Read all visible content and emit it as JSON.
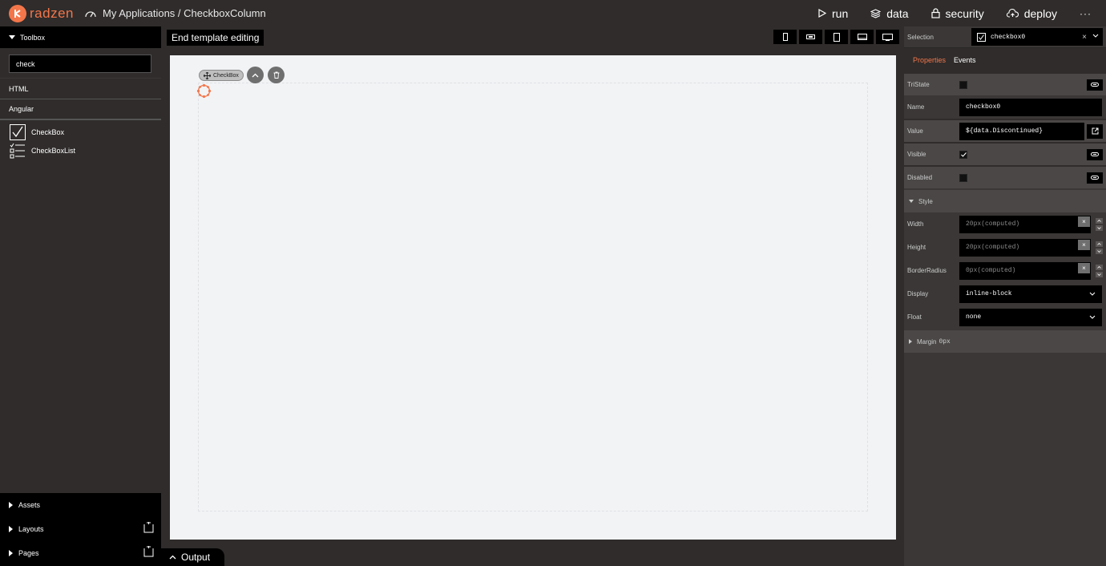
{
  "brand": {
    "name": "radzen",
    "accent": "#f3764a"
  },
  "breadcrumb": "My Applications / CheckboxColumn",
  "topnav": [
    {
      "label": "run",
      "icon": "play-icon"
    },
    {
      "label": "data",
      "icon": "layers-icon"
    },
    {
      "label": "security",
      "icon": "lock-icon"
    },
    {
      "label": "deploy",
      "icon": "cloud-upload-icon"
    },
    {
      "label": "···",
      "icon": "more-icon"
    }
  ],
  "toolbox": {
    "title": "Toolbox",
    "search_value": "check",
    "categories": [
      "HTML",
      "Angular"
    ],
    "tools": [
      "CheckBox",
      "CheckBoxList"
    ],
    "bottom": [
      "Assets",
      "Layouts",
      "Pages"
    ]
  },
  "center": {
    "end_template": "End template editing",
    "devices": [
      "phone-portrait-icon",
      "phone-landscape-icon",
      "tablet-portrait-icon",
      "tablet-landscape-icon",
      "desktop-icon"
    ],
    "chip_label": "CheckBox",
    "output_label": "Output"
  },
  "properties": {
    "selection_label": "Selection",
    "selection_value": "checkbox0",
    "tabs": [
      "Properties",
      "Events"
    ],
    "tristate_label": "TriState",
    "name_label": "Name",
    "name_value": "checkbox0",
    "value_label": "Value",
    "value_value": "${data.Discontinued}",
    "visible_label": "Visible",
    "disabled_label": "Disabled",
    "style_label": "Style",
    "width_label": "Width",
    "width_placeholder": "20px(computed)",
    "height_label": "Height",
    "height_placeholder": "20px(computed)",
    "radius_label": "BorderRadius",
    "radius_placeholder": "0px(computed)",
    "display_label": "Display",
    "display_value": "inline-block",
    "float_label": "Float",
    "float_value": "none",
    "margin_label": "Margin",
    "margin_value": "0px",
    "clear_symbol": "×"
  }
}
